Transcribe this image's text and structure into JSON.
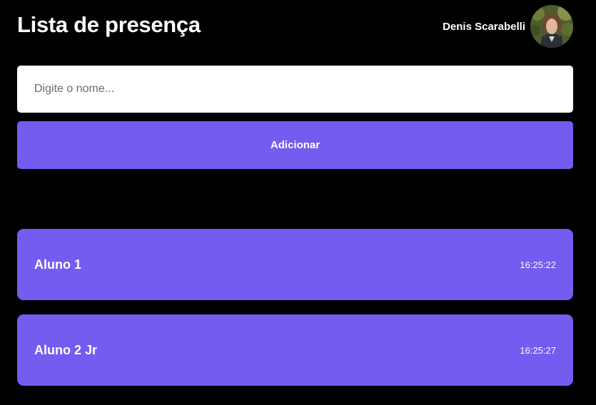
{
  "header": {
    "title": "Lista de presença",
    "user_name": "Denis Scarabelli"
  },
  "form": {
    "input_placeholder": "Digite o nome...",
    "input_value": "",
    "add_label": "Adicionar"
  },
  "students": [
    {
      "name": "Aluno 1",
      "time": "16:25:22"
    },
    {
      "name": "Aluno 2 Jr",
      "time": "16:25:27"
    }
  ],
  "colors": {
    "background": "#000000",
    "accent": "#735cf0",
    "text": "#ffffff"
  }
}
